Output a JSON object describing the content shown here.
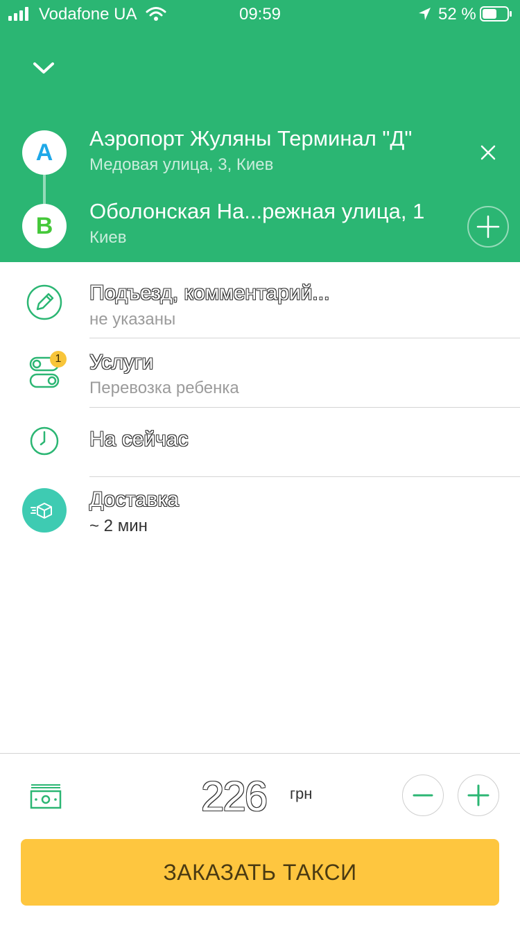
{
  "status_bar": {
    "carrier": "Vodafone UA",
    "time": "09:59",
    "battery": "52 %"
  },
  "route": {
    "point_a": {
      "badge": "A",
      "title": "Аэропорт Жуляны Терминал \"Д\"",
      "subtitle": "Медовая улица, 3, Киев"
    },
    "point_b": {
      "badge": "B",
      "title": "Оболонская На...режная улица, 1",
      "subtitle": "Киев"
    }
  },
  "options": {
    "comment": {
      "title": "Подъезд, комментарий...",
      "subtitle": "не указаны"
    },
    "services": {
      "title": "Услуги",
      "subtitle": "Перевозка ребенка",
      "badge": "1"
    },
    "time": {
      "title": "На сейчас"
    },
    "tariff": {
      "title": "Доставка",
      "subtitle": "~ 2 мин"
    }
  },
  "price": {
    "amount": "226",
    "currency": "грн"
  },
  "order_button": {
    "label": "ЗАКАЗАТЬ ТАКСИ"
  },
  "colors": {
    "header": "#2bb673",
    "accent": "#2bb673",
    "tariff_icon": "#3ecbb2",
    "badge": "#f8c53a",
    "order_button": "#fec63f"
  }
}
